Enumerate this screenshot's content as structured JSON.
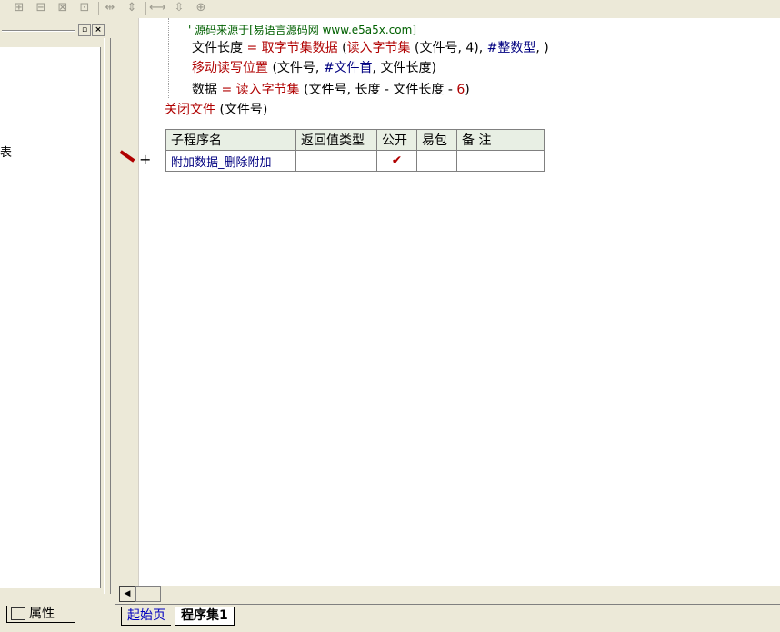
{
  "left_panel": {
    "partial_text": "表",
    "tab_label": "属性"
  },
  "code": {
    "line1_comment": "' 源码来源于[易语言源码网 www.e5a5x.com]",
    "line2_var": "文件长度",
    "line2_op": " = ",
    "line2_func": "取字节集数据",
    "line2_paren_open": " (",
    "line2_inner": "读入字节集",
    "line2_args": " (文件号, 4), ",
    "line2_const": "#整数型",
    "line2_end": ", )",
    "line3_func": "移动读写位置",
    "line3_args": " (文件号, ",
    "line3_const": "#文件首",
    "line3_end": ", 文件长度)",
    "line4_var": "数据",
    "line4_op": " = ",
    "line4_func": "读入字节集",
    "line4_args": " (文件号, 长度 - 文件长度 - ",
    "line4_num": "6",
    "line4_end": ")",
    "line5_func": "关闭文件",
    "line5_args": " (文件号)"
  },
  "sub_table": {
    "headers": [
      "子程序名",
      "返回值类型",
      "公开",
      "易包",
      "备 注"
    ],
    "row": {
      "name": "附加数据_删除附加",
      "return_type": "",
      "public_mark": "✔",
      "package": "",
      "note": ""
    }
  },
  "gutter": {
    "plus": "+"
  },
  "doc_tabs": {
    "start_page": "起始页",
    "program_set": "程序集1"
  },
  "colors": {
    "keyword_red": "#b00000",
    "identifier_blue": "#000080",
    "table_header_bg": "#e8efe4"
  }
}
